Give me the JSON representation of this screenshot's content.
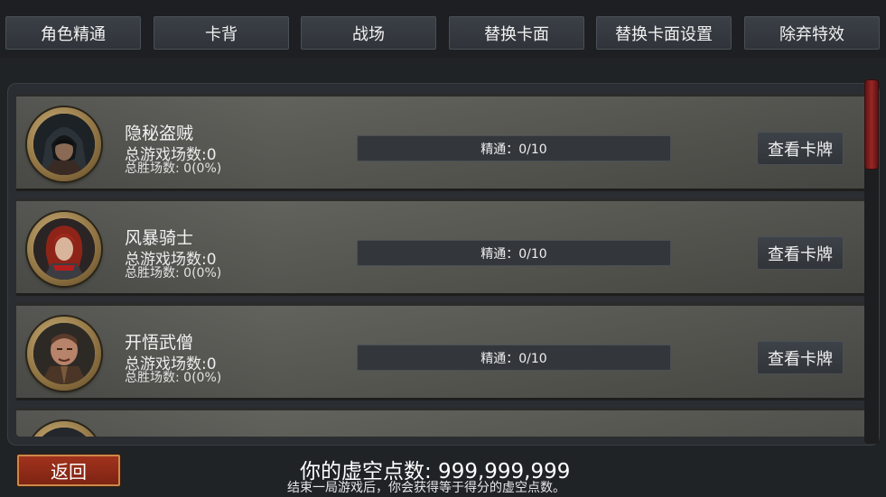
{
  "tabs": [
    {
      "label": "角色精通"
    },
    {
      "label": "卡背"
    },
    {
      "label": "战场"
    },
    {
      "label": "替换卡面"
    },
    {
      "label": "替换卡面设置"
    },
    {
      "label": "除弃特效"
    }
  ],
  "heroes": [
    {
      "name": "隐秘盗贼",
      "games": "总游戏场数:0",
      "wins": "总胜场数: 0(0%)",
      "mastery": "精通：0/10",
      "view_label": "查看卡牌",
      "portrait_icon": "hooded-rogue-portrait"
    },
    {
      "name": "风暴骑士",
      "games": "总游戏场数:0",
      "wins": "总胜场数: 0(0%)",
      "mastery": "精通：0/10",
      "view_label": "查看卡牌",
      "portrait_icon": "red-haired-knight-portrait"
    },
    {
      "name": "开悟武僧",
      "games": "总游戏场数:0",
      "wins": "总胜场数: 0(0%)",
      "mastery": "精通：0/10",
      "view_label": "查看卡牌",
      "portrait_icon": "monk-portrait"
    }
  ],
  "footer": {
    "back_label": "返回",
    "void_points": "你的虚空点数: 999,999,999",
    "void_note": "结束一局游戏后，你会获得等于得分的虚空点数。"
  },
  "colors": {
    "back_button": "#8f2a17",
    "scroll_thumb": "#9a2525",
    "row_stone": "#565751"
  }
}
